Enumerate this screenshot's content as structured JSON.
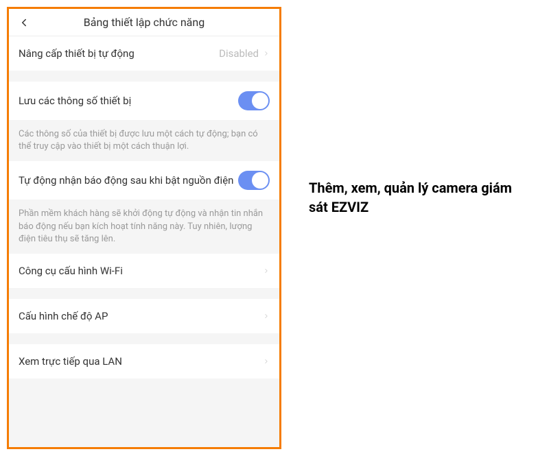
{
  "header": {
    "title": "Bảng thiết lập chức năng"
  },
  "rows": {
    "auto_upgrade": {
      "label": "Nâng cấp thiết bị tự động",
      "value": "Disabled"
    },
    "save_params": {
      "label": "Lưu các thông số thiết bị",
      "help": "Các thông số của thiết bị được lưu một cách tự động; bạn có thể truy cập vào thiết bị một cách thuận lợi."
    },
    "auto_alarm": {
      "label": "Tự động nhận báo động sau khi bật nguồn điện",
      "help": "Phần mềm khách hàng sẽ khởi động tự động và nhận tin nhắn báo động nếu bạn kích hoạt tính năng này. Tuy nhiên, lượng điện tiêu thụ sẽ tăng lên."
    },
    "wifi_tool": {
      "label": "Công cụ cấu hình Wi-Fi"
    },
    "ap_mode": {
      "label": "Cấu hình chế độ AP"
    },
    "lan_view": {
      "label": "Xem trực tiếp qua LAN"
    }
  },
  "caption": "Thêm, xem, quản lý camera giám sát EZVIZ"
}
